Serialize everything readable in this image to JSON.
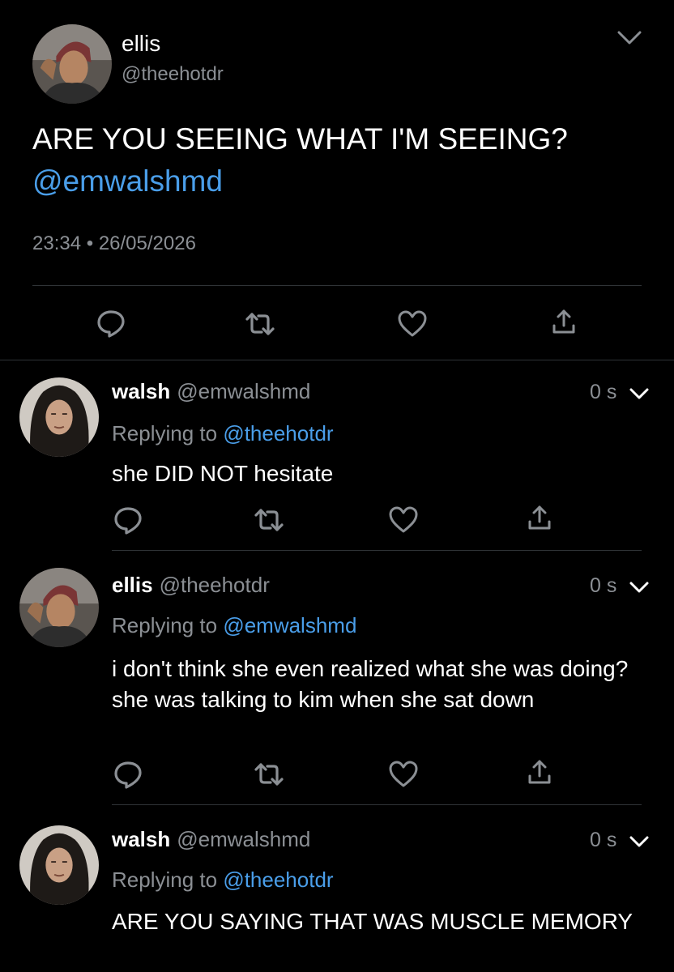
{
  "main_tweet": {
    "name": "ellis",
    "handle": "@theehotdr",
    "text": "ARE YOU SEEING WHAT I'M SEEING?",
    "mention": "@emwalshmd",
    "time": "23:34",
    "date_sep": "•",
    "date": "26/05/2026"
  },
  "replies": [
    {
      "name": "walsh",
      "handle": "@emwalshmd",
      "time": "0 s",
      "replying_prefix": "Replying to",
      "replying_to": "@theehotdr",
      "text": "she DID NOT hesitate"
    },
    {
      "name": "ellis",
      "handle": "@theehotdr",
      "time": "0 s",
      "replying_prefix": "Replying to",
      "replying_to": "@emwalshmd",
      "text": "i don't think she even realized what she was doing? she was talking to kim when she sat down"
    },
    {
      "name": "walsh",
      "handle": "@emwalshmd",
      "time": "0 s",
      "replying_prefix": "Replying to",
      "replying_to": "@theehotdr",
      "text": "ARE YOU SAYING THAT WAS MUSCLE MEMORY"
    }
  ],
  "icons": {
    "reply": "reply-icon",
    "retweet": "retweet-icon",
    "like": "heart-icon",
    "share": "share-icon",
    "menu": "chevron-down-icon"
  },
  "colors": {
    "background": "#000000",
    "text": "#ffffff",
    "secondary": "#8b8f94",
    "link": "#4a9ee9",
    "divider": "#2f3336"
  }
}
